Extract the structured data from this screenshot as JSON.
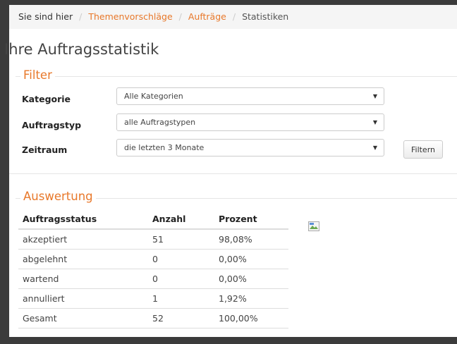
{
  "breadcrumb": {
    "prefix": "Sie sind hier",
    "separator": "/",
    "items": [
      {
        "label": "Themenvorschläge"
      },
      {
        "label": "Aufträge"
      }
    ],
    "current": "Statistiken"
  },
  "page": {
    "title": "Ihre Auftragsstatistik"
  },
  "filter": {
    "legend": "Filter",
    "fields": [
      {
        "label": "Kategorie",
        "value": "Alle Kategorien"
      },
      {
        "label": "Auftragstyp",
        "value": "alle Auftragstypen"
      },
      {
        "label": "Zeitraum",
        "value": "die letzten 3 Monate"
      }
    ],
    "button_label": "Filtern",
    "caret": "▼"
  },
  "auswertung": {
    "legend": "Auswertung",
    "columns": [
      "Auftragsstatus",
      "Anzahl",
      "Prozent"
    ],
    "rows": [
      [
        "akzeptiert",
        "51",
        "98,08%"
      ],
      [
        "abgelehnt",
        "0",
        "0,00%"
      ],
      [
        "wartend",
        "0",
        "0,00%"
      ],
      [
        "annulliert",
        "1",
        "1,92%"
      ],
      [
        "Gesamt",
        "52",
        "100,00%"
      ]
    ]
  },
  "colors": {
    "accent": "#e8782a",
    "frame": "#3b3b3b",
    "breadcrumb_bg": "#f5f5f5"
  }
}
